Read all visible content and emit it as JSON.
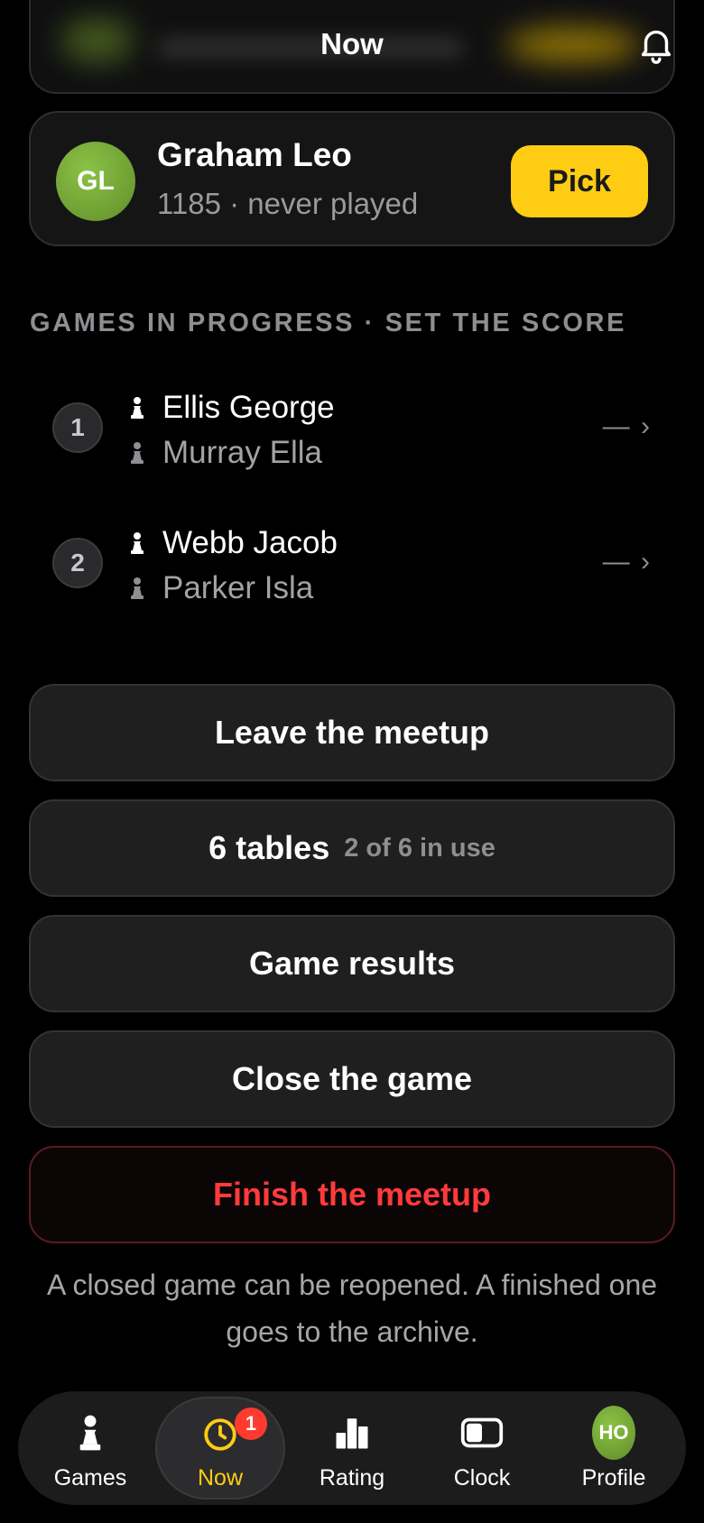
{
  "header": {
    "title": "Now",
    "bell_icon": "bell-icon"
  },
  "candidate": {
    "initials": "GL",
    "name": "Graham Leo",
    "meta": "1185 · never played",
    "pick_label": "Pick"
  },
  "section": {
    "label": "GAMES IN PROGRESS · SET THE SCORE"
  },
  "games": [
    {
      "number": "1",
      "white": "Ellis George",
      "black": "Murray Ella",
      "score": "— ›"
    },
    {
      "number": "2",
      "white": "Webb Jacob",
      "black": "Parker Isla",
      "score": "— ›"
    }
  ],
  "actions": {
    "leave": "Leave the meetup",
    "tables": "6 tables",
    "tables_sub": "2 of 6 in use",
    "results": "Game results",
    "close": "Close the game",
    "finish": "Finish the meetup"
  },
  "footnote": "A closed game can be reopened. A finished one goes to the archive.",
  "tabs": {
    "games": "Games",
    "now": "Now",
    "now_badge": "1",
    "rating": "Rating",
    "clock": "Clock",
    "profile": "Profile",
    "profile_initials": "HO"
  },
  "colors": {
    "accent": "#ffcc14",
    "danger": "#ff3b3b",
    "badge": "#ff3b30"
  }
}
